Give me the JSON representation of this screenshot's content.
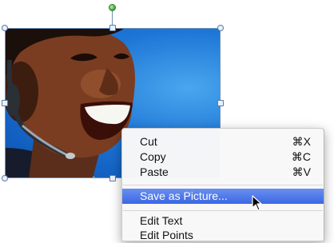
{
  "picture": {
    "alt": "Smiling man wearing a headset on a blue background"
  },
  "context_menu": {
    "items": [
      {
        "label": "Cut",
        "shortcut": "⌘X"
      },
      {
        "label": "Copy",
        "shortcut": "⌘C"
      },
      {
        "label": "Paste",
        "shortcut": "⌘V"
      },
      {
        "label": "Save as Picture...",
        "shortcut": "",
        "highlighted": true
      },
      {
        "label": "Edit Text",
        "shortcut": ""
      },
      {
        "label": "Edit Points",
        "shortcut": ""
      }
    ]
  },
  "colors": {
    "highlight": "#3a68e3",
    "selection_border": "#6d8fb8",
    "rotation_handle": "#3fa33a"
  },
  "icons": [
    "rotation-handle",
    "resize-handle",
    "arrow-cursor"
  ]
}
